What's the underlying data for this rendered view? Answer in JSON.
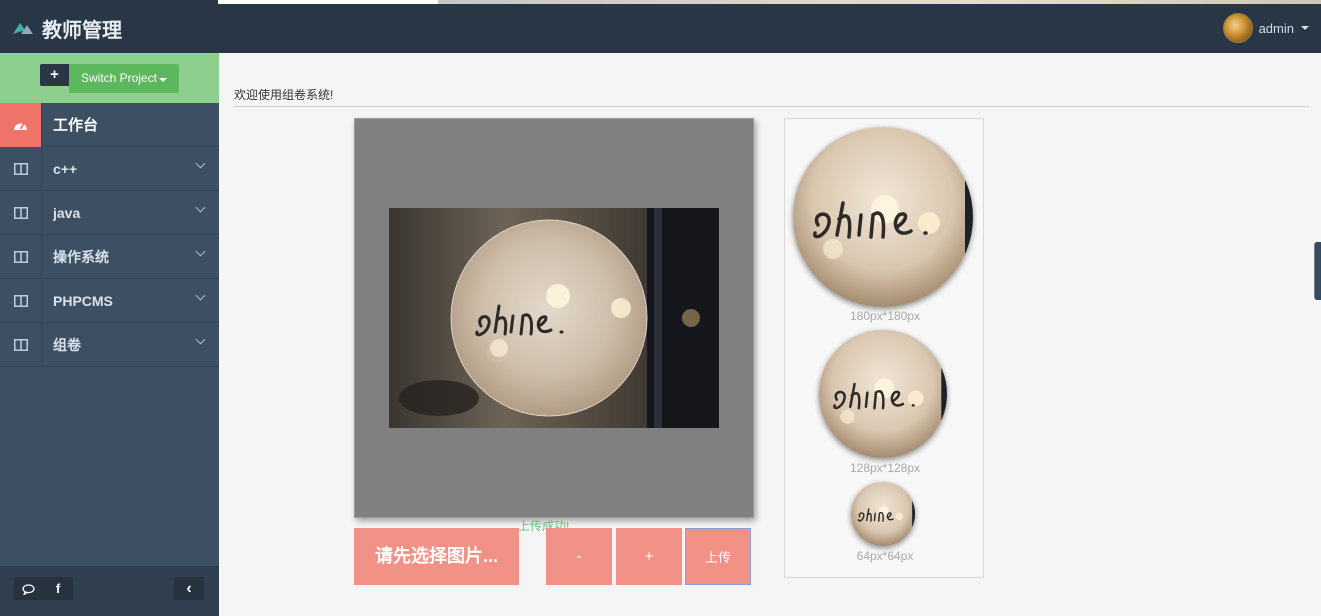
{
  "header": {
    "title": "教师管理",
    "user": "admin"
  },
  "sidebar": {
    "switch_label": "Switch Project",
    "add_symbol": "+",
    "items": [
      {
        "label": "工作台",
        "icon": "dashboard-icon",
        "active": true
      },
      {
        "label": "c++",
        "icon": "columns-icon",
        "active": false
      },
      {
        "label": "java",
        "icon": "columns-icon",
        "active": false
      },
      {
        "label": "操作系统",
        "icon": "columns-icon",
        "active": false
      },
      {
        "label": "PHPCMS",
        "icon": "columns-icon",
        "active": false
      },
      {
        "label": "组卷",
        "icon": "columns-icon",
        "active": false
      }
    ],
    "footer": {
      "chat_symbol": "💬",
      "facebook_symbol": "f",
      "collapse_symbol": "‹"
    }
  },
  "main": {
    "welcome": "欢迎使用组卷系统!",
    "previews": [
      {
        "label": "180px*180px"
      },
      {
        "label": "128px*128px"
      },
      {
        "label": "64px*64px"
      }
    ],
    "buttons": {
      "select": "请先选择图片...",
      "zoom_out": "-",
      "zoom_in": "+",
      "upload": "上传"
    },
    "status": "上传成功!"
  },
  "colors": {
    "topbar": "#283646",
    "sidebar": "#3d4f63",
    "accent": "#f29186",
    "project_green": "#8ecf8e",
    "success_text": "#68c07a"
  }
}
